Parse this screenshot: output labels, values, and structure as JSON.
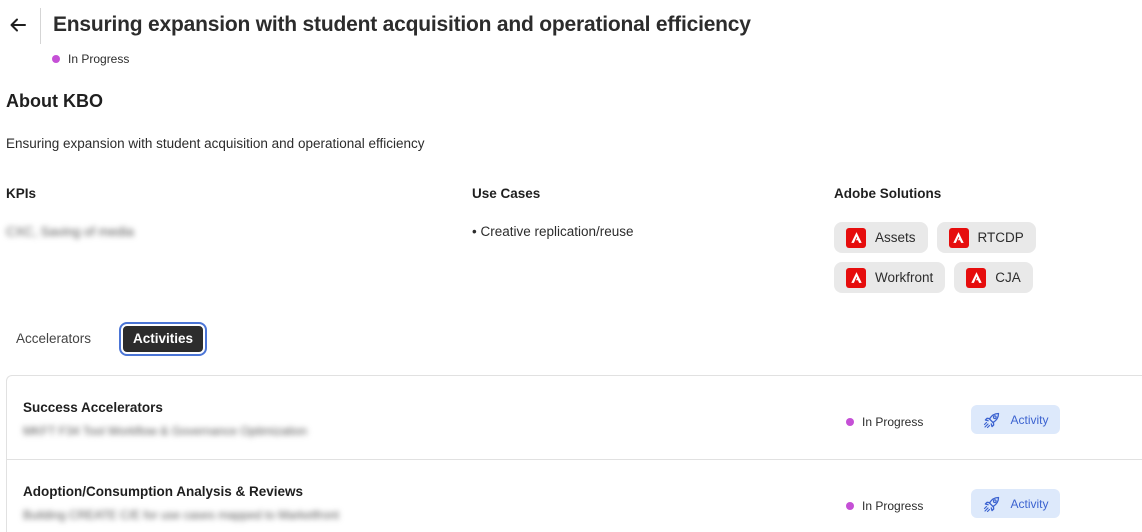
{
  "header": {
    "title": "Ensuring expansion with student acquisition and operational efficiency",
    "status": "In Progress"
  },
  "about": {
    "heading": "About KBO",
    "description": "Ensuring expansion with student acquisition and operational efficiency"
  },
  "columns": {
    "kpis_label": "KPIs",
    "kpis_value": "CXC, Saving of media",
    "use_cases_label": "Use Cases",
    "use_cases": [
      "• Creative replication/reuse"
    ],
    "solutions_label": "Adobe Solutions",
    "solutions": [
      "Assets",
      "RTCDP",
      "Workfront",
      "CJA"
    ]
  },
  "tabs": [
    "Accelerators",
    "Activities"
  ],
  "active_tab": "Activities",
  "rows": [
    {
      "title": "Success Accelerators",
      "subtitle": "MKFT F34 Tool Workflow & Governance Optimization",
      "status": "In Progress",
      "action": "Activity"
    },
    {
      "title": "Adoption/Consumption Analysis & Reviews",
      "subtitle": "Building CREATE C/E for use cases mapped to Marketfront",
      "status": "In Progress",
      "action": "Activity"
    }
  ],
  "colors": {
    "status_in_progress": "#c550d6",
    "adobe_red": "#e60d0d",
    "activity_bg": "#dde9fb",
    "activity_text": "#3c63d0",
    "tab_focus": "#4b75d6"
  },
  "icons": {
    "back": "arrow-left-icon",
    "solution": "adobe-logo-icon",
    "activity": "rocket-icon"
  }
}
